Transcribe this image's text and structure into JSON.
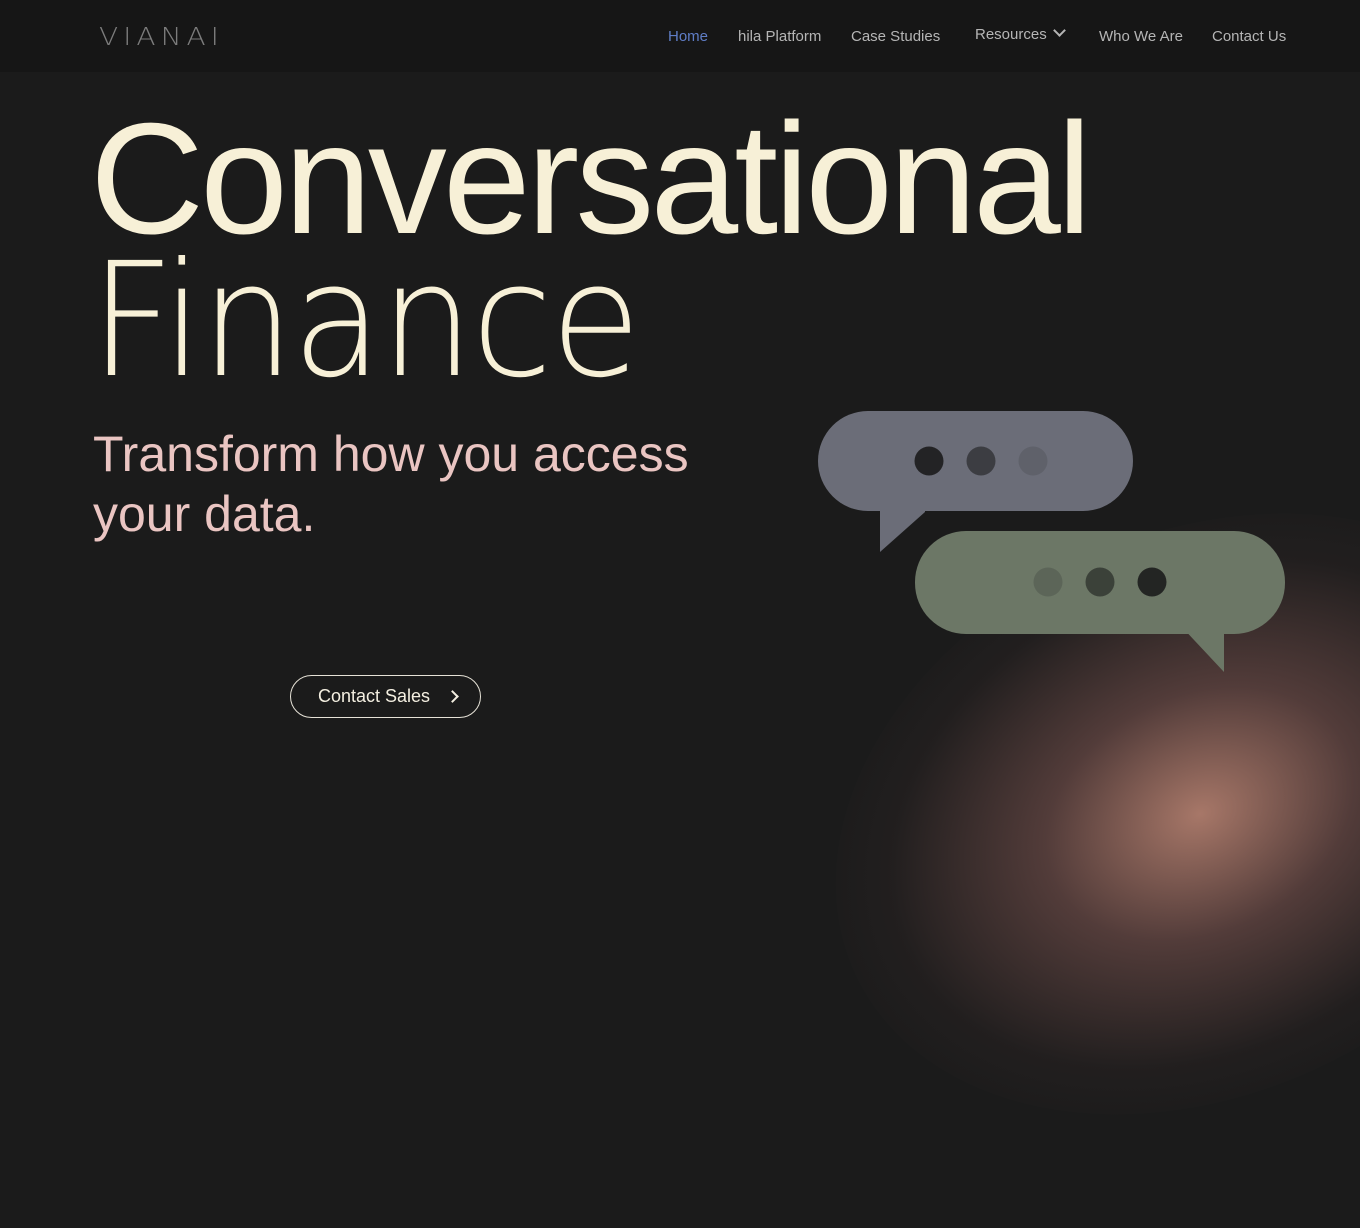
{
  "brand": {
    "logo_text": "VIANAI"
  },
  "nav": {
    "items": [
      {
        "label": "Home",
        "active": true
      },
      {
        "label": "hila Platform"
      },
      {
        "label": "Case Studies"
      },
      {
        "label": "Resources",
        "has_dropdown": true
      },
      {
        "label": "Who We Are"
      },
      {
        "label": "Contact Us"
      }
    ]
  },
  "hero": {
    "title_line1": "Conversational",
    "title_line2": "Finance",
    "subtitle": "Transform how you access your data.",
    "cta_label": "Contact Sales"
  },
  "colors": {
    "background": "#1b1b1b",
    "nav_active": "#5f7dc6",
    "title": "#f7f0d7",
    "subtitle": "#eac5c2",
    "bubble_grey": "#6b6d78",
    "bubble_green": "#6c7766"
  }
}
